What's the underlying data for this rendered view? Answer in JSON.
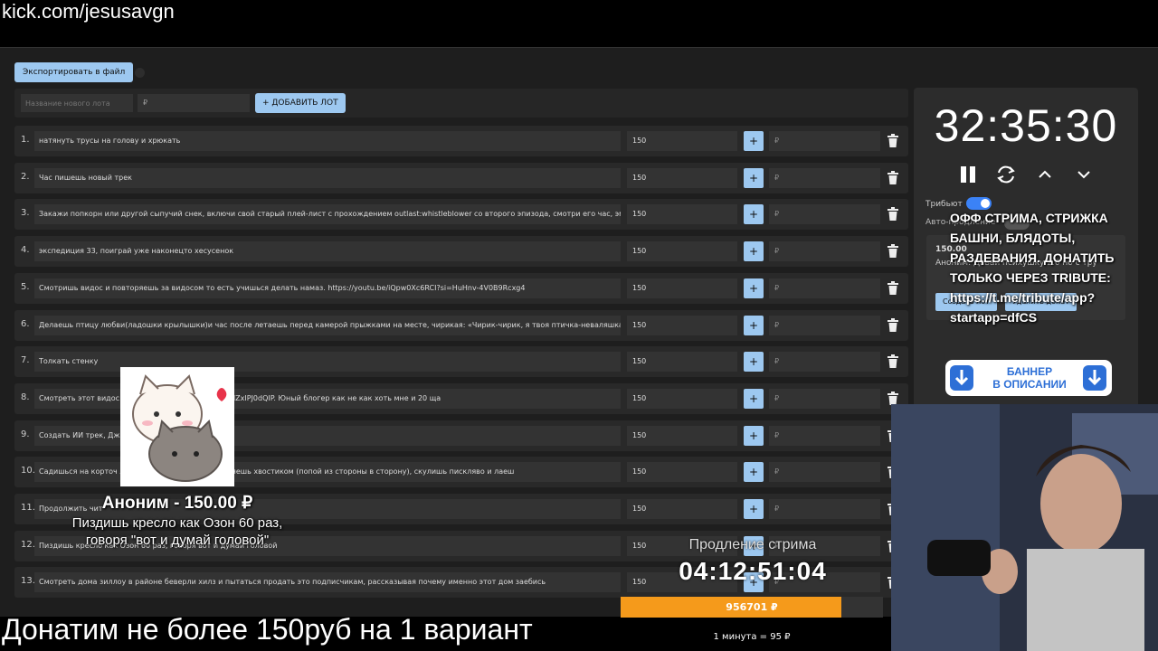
{
  "stream_url": "kick.com/jesusavgn",
  "toolbar": {
    "export_label": "Экспортировать в файл"
  },
  "new_lot": {
    "name_placeholder": "Название нового лота",
    "price_placeholder": "₽",
    "add_label": "+ ДОБАВИТЬ ЛОТ"
  },
  "lots": [
    {
      "num": "1.",
      "name": "натянуть трусы на голову и хрюкать",
      "sum": "150",
      "donate": "₽"
    },
    {
      "num": "2.",
      "name": "Час пишешь новый трек",
      "sum": "150",
      "donate": "₽"
    },
    {
      "num": "3.",
      "name": "Закажи попкорн или другой сыпучий снек, включи свой старый плей-лист с прохождением outlast:whistleblower со второго эпизода, смотри его час, эмоци",
      "sum": "150",
      "donate": "₽"
    },
    {
      "num": "4.",
      "name": "экспедиция 33, поиграй уже наконецто хесусенок",
      "sum": "150",
      "donate": "₽"
    },
    {
      "num": "5.",
      "name": "Смотришь видос и повторяешь за видосом то есть учишься делать намаз. https://youtu.be/iQpw0Xc6RCI?si=HuHnv-4V0B9Rcxg4",
      "sum": "150",
      "donate": "₽"
    },
    {
      "num": "6.",
      "name": "Делаешь птицу любви(ладошки крылышки)и час после летаешь перед камерой прыжками на месте, чирикая: «Чирик-чирик, я твоя птичка-неваляшка, мо",
      "sum": "150",
      "donate": "₽"
    },
    {
      "num": "7.",
      "name": "Толкать стенку",
      "sum": "150",
      "donate": "₽"
    },
    {
      "num": "8.",
      "name": "Смотреть этот видос в                          e/QTWKR2GLKn4?si=vb34BMZxIPJ0dQIP. Юный блогер как не как хоть мне и 20 ща",
      "sum": "150",
      "donate": "₽"
    },
    {
      "num": "9.",
      "name": "Создать ИИ трек, Джи",
      "sum": "150",
      "donate": "₽"
    },
    {
      "num": "10.",
      "name": "Садишься на корточ                           лапки перед грудью, час виляешь хвостиком (попой из стороны в сторону), скулишь пискляво и лаеш",
      "sum": "150",
      "donate": "₽"
    },
    {
      "num": "11.",
      "name": "Продолжить чит",
      "sum": "150",
      "donate": "₽"
    },
    {
      "num": "12.",
      "name": "Пиздишь кресло как Озон 60 раз, говоря вот и думай головой",
      "sum": "150",
      "donate": "₽"
    },
    {
      "num": "13.",
      "name": "Смотреть дома зиллоу в районе беверли хилз и пытаться продать это подписчикам, рассказывая почему именно этот дом заебись",
      "sum": "150",
      "donate": "₽"
    }
  ],
  "timer": {
    "time": "32:35:30",
    "tribute_label": "Трибьют",
    "auto_label": "Авто-продление",
    "card_amount": "150.00",
    "card_text": "Аноним: Давай психушку 2.0 но с тру",
    "card_btn1": "Создать лот",
    "card_btn2": "Удалить донат"
  },
  "overlay_text": "ОФФ СТРИМА, СТРИЖКА БАШНИ, БЛЯДОТЫ, РАЗДЕВАНИЯ. ДОНАТИТЬ ТОЛЬКО ЧЕРЕЗ TRIBUTE: https://t.me/tribute/app?startapp=dfCS",
  "banner": {
    "line1": "БАННЕР",
    "line2": "В ОПИСАНИИ"
  },
  "alert": {
    "title": "Аноним - 150.00 ₽",
    "message": "Пиздишь кресло как Озон 60 раз, говоря \"вот и думай головой\""
  },
  "extension": {
    "label": "Продление стрима",
    "timer": "04:12:51:04"
  },
  "progress": {
    "label": "956701 ₽",
    "fraction": 0.84
  },
  "rate": "1 минута = 95 ₽",
  "bottom_banner": "Донатим не более 150руб на 1 вариант",
  "colors": {
    "accent": "#9dc8f0",
    "progress": "#f59a1b",
    "toggle_on": "#3b82f6"
  }
}
